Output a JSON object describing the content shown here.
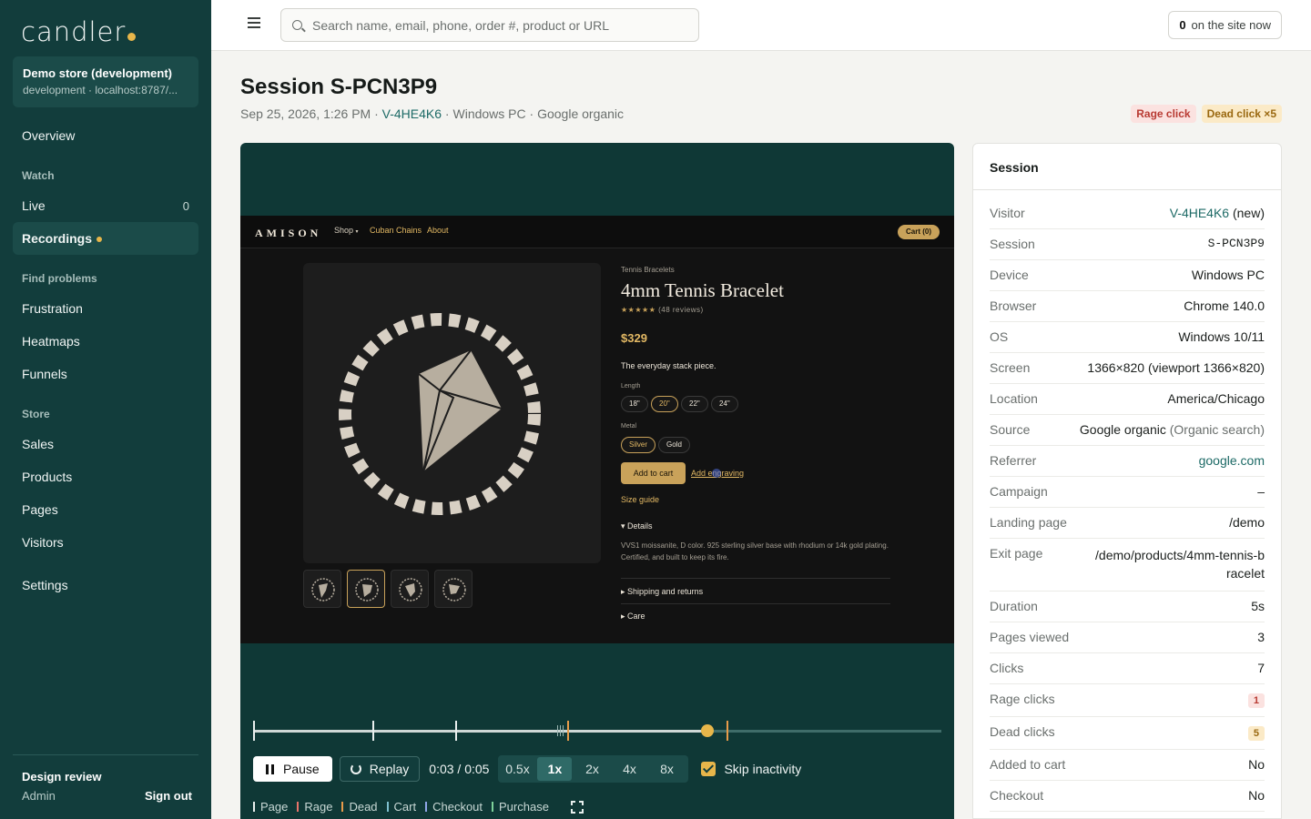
{
  "sidebar": {
    "logo": "candler",
    "store_name": "Demo store (development)",
    "store_sub": "development · localhost:8787/...",
    "overview": "Overview",
    "section_watch": "Watch",
    "live": "Live",
    "live_count": "0",
    "recordings": "Recordings",
    "section_find": "Find problems",
    "frustration": "Frustration",
    "heatmaps": "Heatmaps",
    "funnels": "Funnels",
    "section_store": "Store",
    "sales": "Sales",
    "products": "Products",
    "pages": "Pages",
    "visitors": "Visitors",
    "settings": "Settings",
    "footer_title": "Design review",
    "footer_role": "Admin",
    "sign_out": "Sign out"
  },
  "topbar": {
    "search_placeholder": "Search name, email, phone, order #, product or URL",
    "onsite_count": "0",
    "onsite_label": "on the site now"
  },
  "header": {
    "title": "Session S-PCN3P9",
    "date": "Sep 25, 2026, 1:26 PM",
    "visitor": "V-4HE4K6",
    "device": "Windows PC",
    "source": "Google organic",
    "badge_rage": "Rage click",
    "badge_dead": "Dead click ×5"
  },
  "replay": {
    "brand": "AMISON",
    "nav_shop": "Shop",
    "nav_cuban": "Cuban Chains",
    "nav_about": "About",
    "cart": "Cart (0)",
    "category": "Tennis Bracelets",
    "product_title": "4mm Tennis Bracelet",
    "stars": "★★★★★",
    "reviews": "(48 reviews)",
    "price": "$329",
    "tagline": "The everyday stack piece.",
    "length_label": "Length",
    "lengths": [
      "18\"",
      "20\"",
      "22\"",
      "24\""
    ],
    "metal_label": "Metal",
    "metals": [
      "Silver",
      "Gold"
    ],
    "add_to_cart": "Add to cart",
    "add_engraving": "Add engraving",
    "size_guide": "Size guide",
    "details": "Details",
    "details_body": "VVS1 moissanite, D color. 925 sterling silver base with rhodium or 14k gold plating. Certified, and built to keep its fire.",
    "shipping": "Shipping and returns",
    "care": "Care"
  },
  "controls": {
    "pause": "Pause",
    "replay": "Replay",
    "time": "0:03 / 0:05",
    "speeds": [
      "0.5x",
      "1x",
      "2x",
      "4x",
      "8x"
    ],
    "active_speed": "1x",
    "skip_inactivity": "Skip inactivity",
    "progress": 0.66
  },
  "legend": [
    {
      "label": "Page",
      "color": "#e9efee"
    },
    {
      "label": "Rage",
      "color": "#e8746a"
    },
    {
      "label": "Dead",
      "color": "#e79b4a"
    },
    {
      "label": "Cart",
      "color": "#7fc0cf"
    },
    {
      "label": "Checkout",
      "color": "#8fa6e8"
    },
    {
      "label": "Purchase",
      "color": "#7ed29a"
    }
  ],
  "panel": {
    "title": "Session",
    "visitor_label": "Visitor",
    "visitor_value": "V-4HE4K6",
    "visitor_new": "(new)",
    "session_label": "Session",
    "session_value": "S-PCN3P9",
    "device_label": "Device",
    "device_value": "Windows PC",
    "browser_label": "Browser",
    "browser_value": "Chrome 140.0",
    "os_label": "OS",
    "os_value": "Windows 10/11",
    "screen_label": "Screen",
    "screen_value": "1366×820 (viewport 1366×820)",
    "location_label": "Location",
    "location_value": "America/Chicago",
    "source_label": "Source",
    "source_value": "Google organic",
    "source_detail": "(Organic search)",
    "referrer_label": "Referrer",
    "referrer_value": "google.com",
    "campaign_label": "Campaign",
    "campaign_value": "–",
    "landing_label": "Landing page",
    "landing_value": "/demo",
    "exit_label": "Exit page",
    "exit_value": "/demo/products/4mm-tennis-bracelet",
    "duration_label": "Duration",
    "duration_value": "5s",
    "pages_label": "Pages viewed",
    "pages_value": "3",
    "clicks_label": "Clicks",
    "clicks_value": "7",
    "rage_label": "Rage clicks",
    "rage_value": "1",
    "dead_label": "Dead clicks",
    "dead_value": "5",
    "cart_label": "Added to cart",
    "cart_value": "No",
    "checkout_label": "Checkout",
    "checkout_value": "No"
  }
}
